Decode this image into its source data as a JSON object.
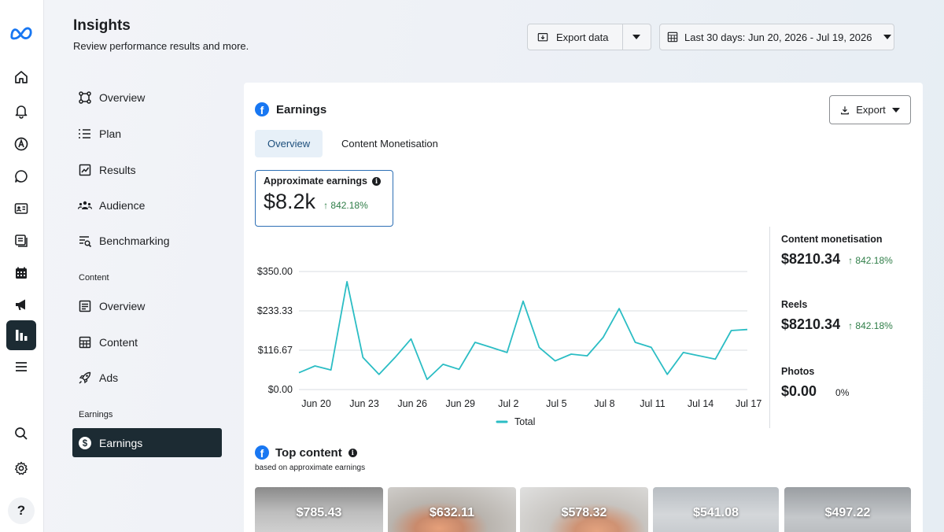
{
  "app": {
    "title": "Insights",
    "subtitle": "Review performance results and more."
  },
  "rail": {
    "icons": [
      "meta-logo-icon",
      "home-icon",
      "bell-icon",
      "at-icon",
      "chat-bubble-icon",
      "contact-card-icon",
      "pages-icon",
      "calendar-icon",
      "megaphone-icon",
      "insights-bar-chart-icon",
      "menu-icon",
      "search-icon",
      "gear-icon",
      "help-icon"
    ],
    "help_label": "?"
  },
  "header": {
    "export_data_label": "Export data",
    "date_range_label": "Last 30 days: Jun 20, 2026 - Jul 19, 2026"
  },
  "sidebar": {
    "items": [
      {
        "label": "Overview",
        "icon": "overview-icon"
      },
      {
        "label": "Plan",
        "icon": "plan-list-icon"
      },
      {
        "label": "Results",
        "icon": "results-chart-icon"
      },
      {
        "label": "Audience",
        "icon": "audience-icon"
      },
      {
        "label": "Benchmarking",
        "icon": "benchmarking-icon"
      }
    ],
    "content_section_label": "Content",
    "content_items": [
      {
        "label": "Overview",
        "icon": "content-overview-icon"
      },
      {
        "label": "Content",
        "icon": "content-grid-icon"
      },
      {
        "label": "Ads",
        "icon": "ads-rocket-icon"
      }
    ],
    "earnings_section_label": "Earnings",
    "earnings_item": {
      "label": "Earnings",
      "icon": "dollar-icon"
    }
  },
  "earnings": {
    "title": "Earnings",
    "export_label": "Export",
    "tabs": [
      "Overview",
      "Content Monetisation"
    ],
    "active_tab": "Overview",
    "approx_label": "Approximate earnings",
    "approx_value": "$8.2k",
    "approx_delta": "842.18%",
    "side_metrics": [
      {
        "label": "Content monetisation",
        "value": "$8210.34",
        "delta": "842.18%"
      },
      {
        "label": "Reels",
        "value": "$8210.34",
        "delta": "842.18%"
      },
      {
        "label": "Photos",
        "value": "$0.00",
        "delta": "0%"
      }
    ]
  },
  "chart_data": {
    "type": "line",
    "title": "",
    "xlabel": "",
    "ylabel": "",
    "ylim": [
      0,
      350
    ],
    "y_ticks": [
      "$350.00",
      "$233.33",
      "$116.67",
      "$0.00"
    ],
    "y_tick_values": [
      350,
      233.33,
      116.67,
      0
    ],
    "x_ticks": [
      "Jun 20",
      "Jun 23",
      "Jun 26",
      "Jun 29",
      "Jul 2",
      "Jul 5",
      "Jul 8",
      "Jul 11",
      "Jul 14",
      "Jul 17"
    ],
    "grid": true,
    "legend": "bottom",
    "color": "#2bbdc4",
    "series": [
      {
        "name": "Total",
        "x": [
          "Jun 20",
          "Jun 21",
          "Jun 22",
          "Jun 23",
          "Jun 24",
          "Jun 25",
          "Jun 26",
          "Jun 27",
          "Jun 28",
          "Jun 29",
          "Jun 30",
          "Jul 1",
          "Jul 2",
          "Jul 3",
          "Jul 4",
          "Jul 5",
          "Jul 6",
          "Jul 7",
          "Jul 8",
          "Jul 9",
          "Jul 10",
          "Jul 11",
          "Jul 12",
          "Jul 13",
          "Jul 14",
          "Jul 15",
          "Jul 16",
          "Jul 17",
          "Jul 18"
        ],
        "values": [
          50,
          70,
          58,
          320,
          95,
          45,
          95,
          150,
          30,
          75,
          60,
          140,
          125,
          110,
          262,
          125,
          85,
          105,
          100,
          155,
          240,
          140,
          125,
          45,
          110,
          100,
          90,
          175,
          178
        ]
      }
    ]
  },
  "top_content": {
    "title": "Top content",
    "subtitle": "based on approximate earnings",
    "items": [
      "$785.43",
      "$632.11",
      "$578.32",
      "$541.08",
      "$497.22"
    ]
  }
}
